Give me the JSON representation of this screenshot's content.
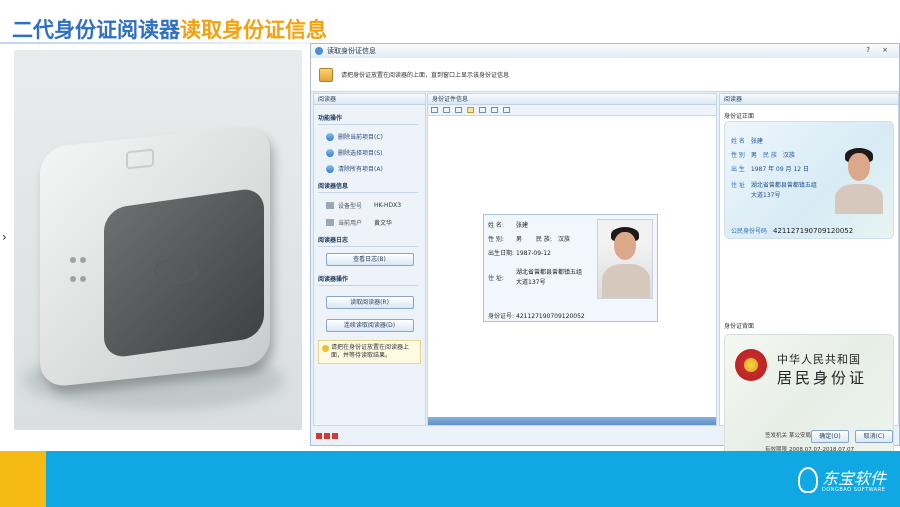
{
  "slide": {
    "title_part1": "二代身份证阅读器",
    "title_part2": "读取身份证信息"
  },
  "window": {
    "title": "读取身份证信息",
    "controls": "? ×",
    "instruction": "请把身份证放置在阅读器的上面，直到窗口上显示该身份证信息"
  },
  "left_panel": {
    "header": "阅读器",
    "function_section": "功能操作",
    "links": [
      {
        "label": "删除当前项目(C)",
        "icon": "globe-icon"
      },
      {
        "label": "删除选择项目(S)",
        "icon": "globe-icon"
      },
      {
        "label": "清除所有项目(A)",
        "icon": "globe-icon"
      }
    ],
    "reader_info_section": "阅读器信息",
    "device_id_label": "设备型号",
    "device_id_value": "HK-HDX3",
    "current_user_label": "当前用户",
    "current_user_value": "黄文华",
    "log_section": "阅读器日志",
    "view_log_button": "查看日志(B)",
    "operation_section": "阅读器操作",
    "read_button": "读取阅读器(R)",
    "continuous_read_button": "连续读取阅读器(D)",
    "tip": "请把在身份证放置在阅读器上面，并等待读取结果。"
  },
  "middle_panel": {
    "header": "身份证件信息",
    "card": {
      "name_label": "姓 名:",
      "name": "张建",
      "gender_label": "性 别:",
      "gender": "男",
      "ethnicity_label": "民 族:",
      "ethnicity": "汉族",
      "birth_label": "出生日期:",
      "birth": "1987-09-12",
      "address_label": "住 址:",
      "address_line1": "湖北省曾都县曾都镇五组",
      "address_line2": "大道137号",
      "id_label": "身份证号:",
      "id_number": "421127190709120052"
    }
  },
  "right_panel": {
    "header": "阅读器",
    "front_label": "身份证正面",
    "back_label": "身份证背面",
    "front": {
      "name_key": "姓 名",
      "name": "张建",
      "gender_key": "性 别",
      "gender": "男",
      "ethnicity_key": "民 族",
      "ethnicity": "汉族",
      "birth_key": "出 生",
      "birth": "1987 年 09 月 12 日",
      "address_key": "住 址",
      "address_line1": "湖北省曾都县曾都镇五组",
      "address_line2": "大道137号",
      "id_key": "公民身份号码",
      "id_number": "421127190709120052"
    },
    "back": {
      "title1": "中华人民共和国",
      "title2": "居民身份证",
      "authority_key": "签发机关",
      "authority": "某公安局",
      "validity_key": "有效期限",
      "validity": "2008.07.07-2018.07.07"
    }
  },
  "footer_buttons": {
    "ok": "确定(O)",
    "cancel": "取消(C)"
  },
  "brand": {
    "name": "东宝软件",
    "english": "DONGBAO SOFTWARE"
  },
  "colors": {
    "title_blue": "#2e6fc4",
    "title_orange": "#f2a20c",
    "band_blue": "#10a8e2",
    "band_yellow": "#f6ba14"
  }
}
